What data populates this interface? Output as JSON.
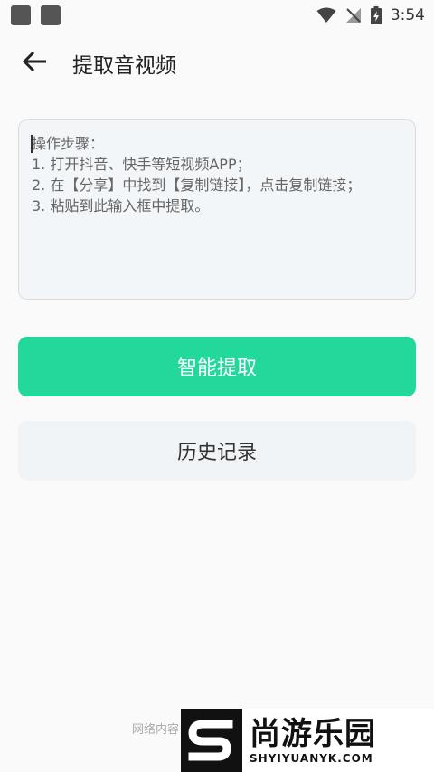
{
  "status_bar": {
    "time": "3:54",
    "icons": [
      "notification-square-icon",
      "notification-square-icon",
      "wifi-icon",
      "no-signal-icon",
      "battery-charging-icon"
    ]
  },
  "app_bar": {
    "back_icon": "arrow-left-icon",
    "title": "提取音视频"
  },
  "input": {
    "placeholder": "操作步骤：\n1. 打开抖音、快手等短视频APP；\n2. 在【分享】中找到【复制链接】，点击复制链接；\n3. 粘贴到此输入框中提取。",
    "value": ""
  },
  "buttons": {
    "extract_label": "智能提取",
    "history_label": "历史记录"
  },
  "footer": {
    "note": "网络内容"
  },
  "watermark": {
    "logo_text": "S",
    "brand_cn": "尚游乐园",
    "brand_en": "SHYIYUANYK.COM"
  },
  "colors": {
    "accent": "#22d89a",
    "secondary_bg": "#f1f4f7",
    "background": "#fafafa"
  }
}
